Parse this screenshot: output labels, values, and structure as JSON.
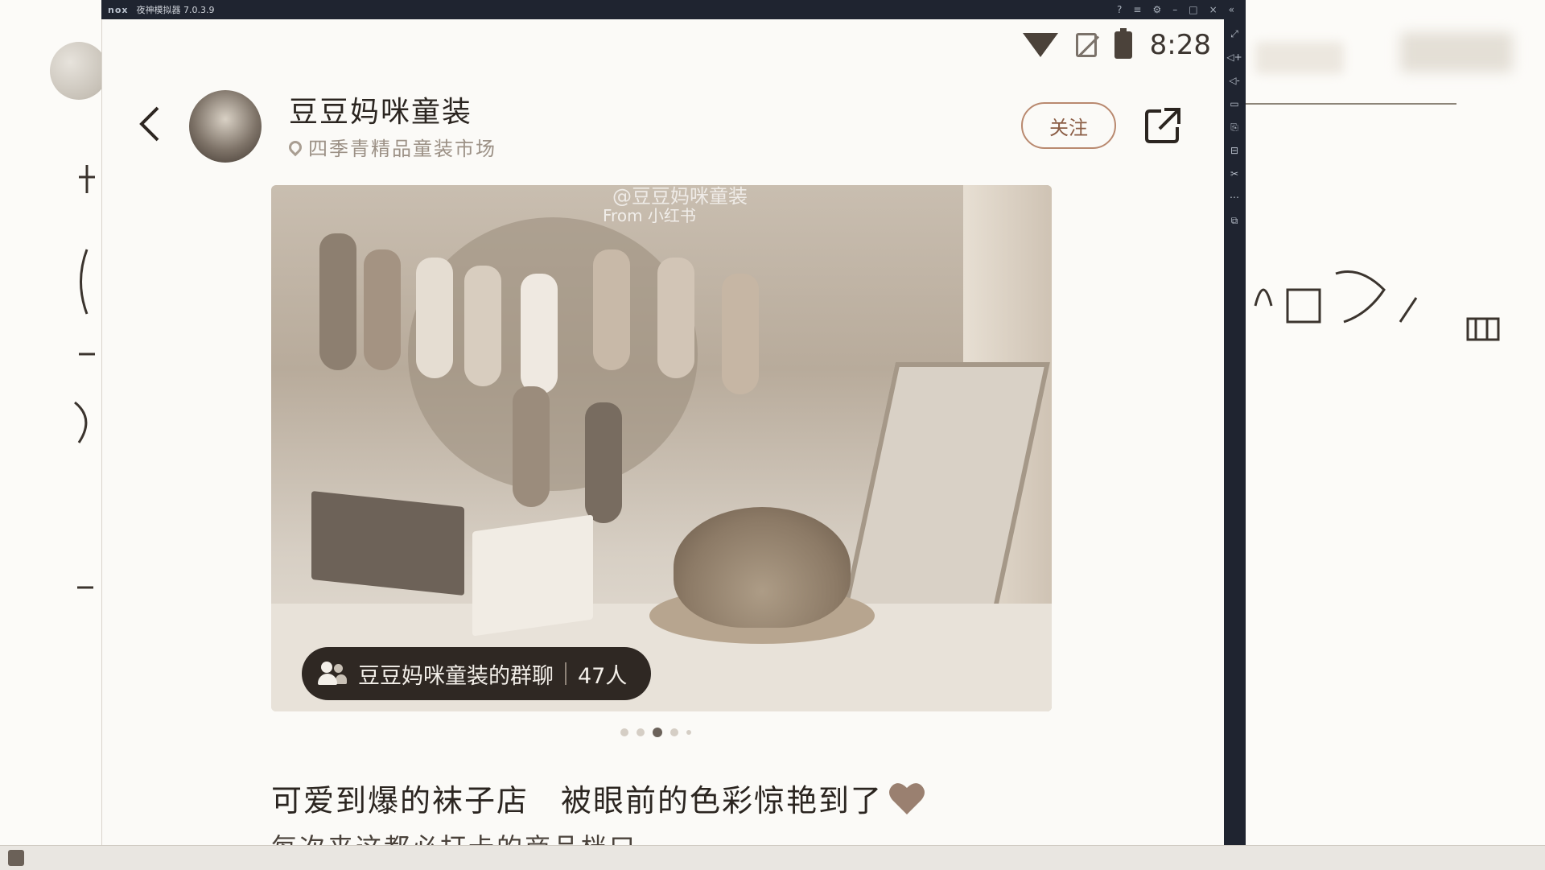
{
  "emulator": {
    "logo": "nox",
    "title": "夜神模拟器 7.0.3.9",
    "title_icons": [
      "?",
      "≡",
      "⚙",
      "–",
      "□",
      "×",
      "«"
    ],
    "sidebar_icons": [
      "⤢",
      "◁+",
      "◁-",
      "▭",
      "⎘",
      "⊟",
      "✂",
      "⋯",
      "⧉"
    ]
  },
  "status_bar": {
    "time": "8:28"
  },
  "header": {
    "back_icon": "chevron-left-icon",
    "shop_name": "豆豆妈咪童装",
    "location": "四季青精品童装市场",
    "follow_label": "关注",
    "share_icon": "share-icon"
  },
  "carousel": {
    "watermark_name": "@豆豆妈咪童装",
    "watermark_from": "From 小红书",
    "group_chat_name": "豆豆妈咪童装的群聊",
    "group_chat_count": "47人",
    "page_count": 5,
    "active_page": 3
  },
  "post": {
    "title": "可爱到爆的袜子店　被眼前的色彩惊艳到了",
    "body_preview": "每次来这都必打卡的商品档口"
  },
  "colors": {
    "accent": "#b9896f",
    "chip_bg": "#2f2823",
    "text": "#2b2520"
  }
}
